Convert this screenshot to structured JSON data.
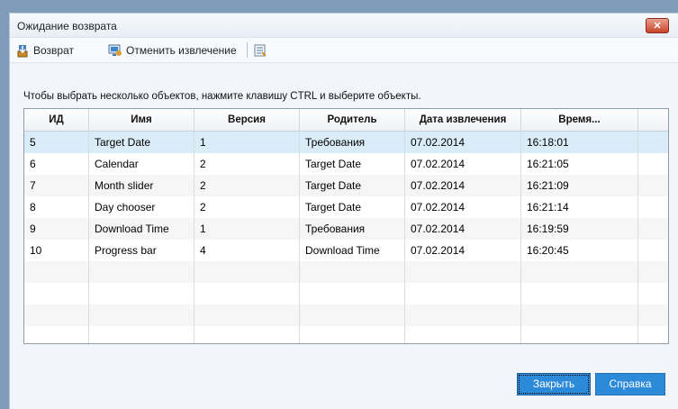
{
  "window": {
    "title": "Ожидание возврата",
    "close_glyph": "✕"
  },
  "toolbar": {
    "checkin_label": "Возврат",
    "undo_checkout_label": "Отменить извлечение"
  },
  "instruction": "Чтобы выбрать несколько объектов, нажмите клавишу CTRL и выберите объекты.",
  "table": {
    "columns": [
      "ИД",
      "Имя",
      "Версия",
      "Родитель",
      "Дата извлечения",
      "Время..."
    ],
    "rows": [
      [
        "5",
        "Target Date",
        "1",
        "Требования",
        "07.02.2014",
        "16:18:01"
      ],
      [
        "6",
        "Calendar",
        "2",
        "Target Date",
        "07.02.2014",
        "16:21:05"
      ],
      [
        "7",
        "Month slider",
        "2",
        "Target Date",
        "07.02.2014",
        "16:21:09"
      ],
      [
        "8",
        "Day chooser",
        "2",
        "Target Date",
        "07.02.2014",
        "16:21:14"
      ],
      [
        "9",
        "Download Time",
        "1",
        "Требования",
        "07.02.2014",
        "16:19:59"
      ],
      [
        "10",
        "Progress bar",
        "4",
        "Download Time",
        "07.02.2014",
        "16:20:45"
      ]
    ],
    "selected_row": 0
  },
  "buttons": {
    "close_label": "Закрыть",
    "help_label": "Справка"
  },
  "colors": {
    "accent": "#2c8ad8",
    "selection": "#d9ecf8",
    "close_red": "#c8442a"
  }
}
